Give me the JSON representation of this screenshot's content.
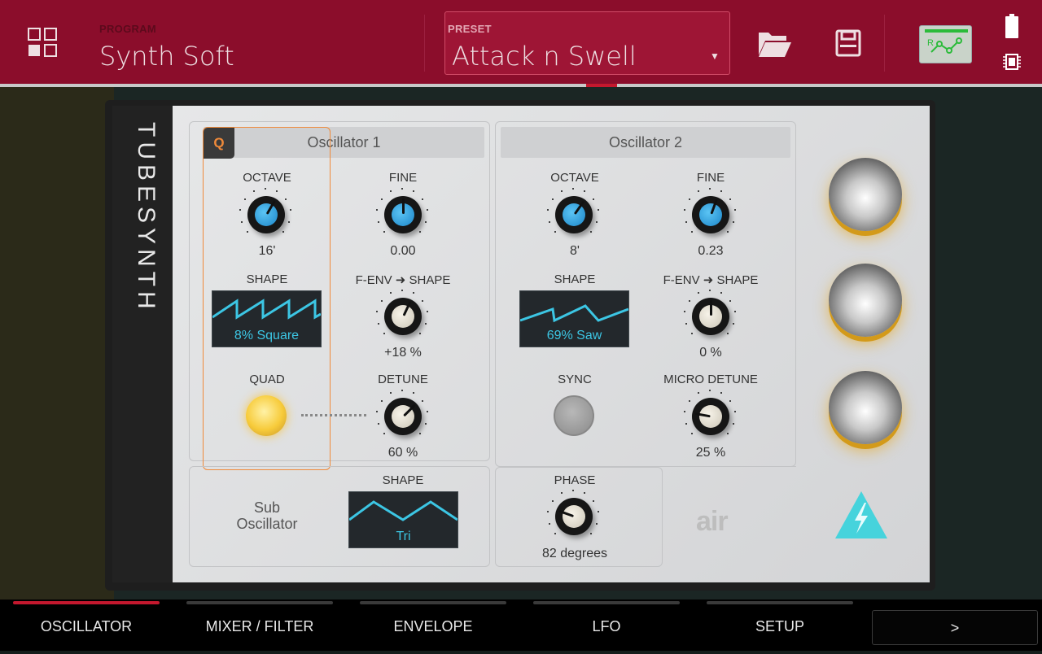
{
  "header": {
    "program_label": "PROGRAM",
    "program_name": "Synth Soft",
    "preset_label": "PRESET",
    "preset_name": "Attack n Swell"
  },
  "plugin": {
    "brand": "TUBESYNTH",
    "osc1": {
      "title": "Oscillator 1",
      "quad_badge": "Q",
      "octave_label": "OCTAVE",
      "octave_value": "16'",
      "fine_label": "FINE",
      "fine_value": "0.00",
      "shape_label": "SHAPE",
      "shape_value": "8% Square",
      "fenv_label": "F-ENV ➜ SHAPE",
      "fenv_value": "+18 %",
      "quad_label": "QUAD",
      "detune_label": "DETUNE",
      "detune_value": "60 %"
    },
    "osc2": {
      "title": "Oscillator 2",
      "octave_label": "OCTAVE",
      "octave_value": "8'",
      "fine_label": "FINE",
      "fine_value": "0.23",
      "shape_label": "SHAPE",
      "shape_value": "69% Saw",
      "fenv_label": "F-ENV ➜ SHAPE",
      "fenv_value": "0 %",
      "sync_label": "SYNC",
      "micro_label": "MICRO DETUNE",
      "micro_value": "25 %"
    },
    "sub": {
      "title": "Sub Oscillator",
      "shape_label": "SHAPE",
      "shape_value": "Tri"
    },
    "phase": {
      "label": "PHASE",
      "value": "82 degrees"
    },
    "air_logo": "air"
  },
  "tabs": [
    {
      "label": "OSCILLATOR",
      "active": true
    },
    {
      "label": "MIXER / FILTER",
      "active": false
    },
    {
      "label": "ENVELOPE",
      "active": false
    },
    {
      "label": "LFO",
      "active": false
    },
    {
      "label": "SETUP",
      "active": false
    }
  ],
  "next_label": ">",
  "colors": {
    "header_bg": "#8b0d2b",
    "accent_red": "#c4182e",
    "knob_blue": "#2a9ad8",
    "shape_cyan": "#3cc6e4",
    "quad_orange": "#f08a3a",
    "macro_gold": "#e8a41c"
  }
}
